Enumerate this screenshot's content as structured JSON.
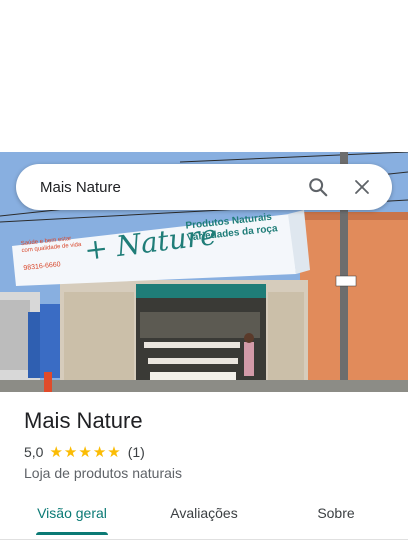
{
  "search": {
    "value": "Mais Nature"
  },
  "photo": {
    "sign_left_line1": "Saúde e bem estar",
    "sign_left_line2": "com qualidade de vida",
    "sign_phone": "98316-6660",
    "sign_logo": "+ Nature",
    "sign_right_line1": "Produtos Naturais",
    "sign_right_line2": "Variedades da roça"
  },
  "place": {
    "name": "Mais Nature",
    "rating": "5,0",
    "stars": 5,
    "review_count": "(1)",
    "category": "Loja de produtos naturais"
  },
  "tabs": [
    {
      "label": "Visão geral",
      "active": true
    },
    {
      "label": "Avaliações",
      "active": false
    },
    {
      "label": "Sobre",
      "active": false
    }
  ],
  "colors": {
    "accent": "#0b7a75",
    "star": "#fbbc04"
  }
}
